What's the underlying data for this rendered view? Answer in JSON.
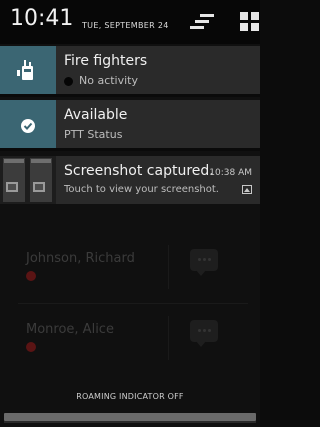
{
  "status_bar": {
    "time": "10:41",
    "date": "TUE, SEPTEMBER 24"
  },
  "header_actions": {
    "clear_all_icon": "clear-notifications-icon",
    "settings_icon": "quick-settings-icon"
  },
  "notifications": [
    {
      "id": "fire-fighters",
      "title": "Fire fighters",
      "subtitle": "No activity",
      "icon": "walkie-talkie-icon",
      "accent": "#3b6673"
    },
    {
      "id": "available",
      "title": "Available",
      "subtitle": "PTT Status",
      "icon": "check-circle-icon",
      "accent": "#3b6673"
    },
    {
      "id": "screenshot",
      "title": "Screenshot captured.",
      "subtitle": "Touch to view your screenshot.",
      "time": "10:38 AM",
      "icon": "screenshot-thumbnail-icon",
      "small_icon": "image-icon"
    }
  ],
  "background_contacts": [
    {
      "name": "Johnson, Richard",
      "status_color": "#5a1414"
    },
    {
      "name": "Monroe, Alice",
      "status_color": "#5a1414"
    }
  ],
  "footer": {
    "roaming_text": "ROAMING INDICATOR OFF"
  },
  "colors": {
    "accent": "#3b6673",
    "notification_bg": "#2a2a2a",
    "shade_bg": "#0c0c0c"
  }
}
